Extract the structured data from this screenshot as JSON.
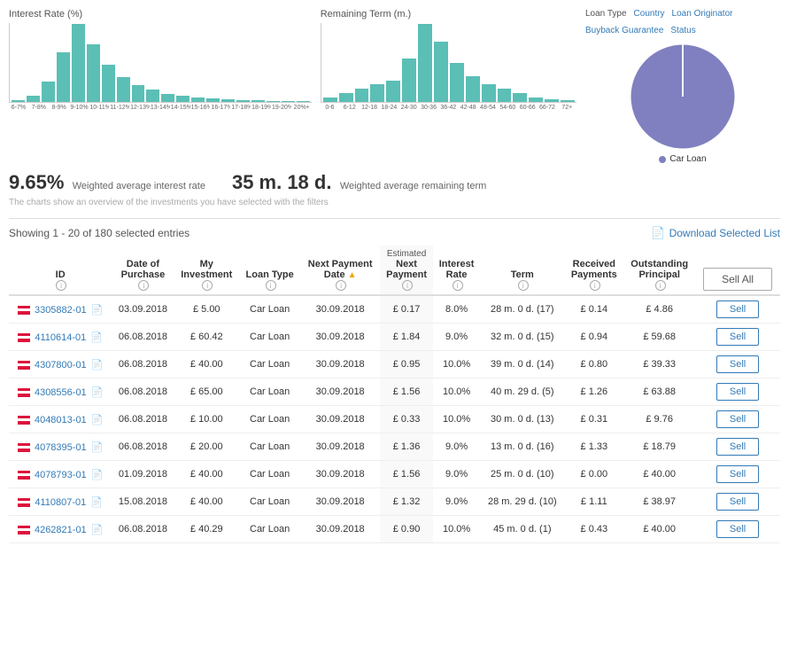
{
  "charts": {
    "interest_rate_title": "Interest Rate (%)",
    "remaining_term_title": "Remaining Term (m.)",
    "interest_bars": [
      2,
      8,
      25,
      60,
      95,
      70,
      45,
      30,
      20,
      15,
      10,
      8,
      5,
      4,
      3,
      2,
      2,
      1,
      1,
      1
    ],
    "interest_labels": [
      "6-7%",
      "7-8%",
      "8-9%",
      "9-10%",
      "10-11%",
      "11-12%",
      "12-13%",
      "13-14%",
      "14-15%",
      "15-16%",
      "16-17%",
      "17-18%",
      "18-19%",
      "19-20%",
      "20%+"
    ],
    "term_bars": [
      5,
      10,
      15,
      20,
      25,
      50,
      90,
      70,
      45,
      30,
      20,
      15,
      10,
      5,
      3,
      2
    ],
    "term_labels": [
      "0-6",
      "6-12",
      "12-18",
      "18-24",
      "24-30",
      "30-36",
      "36-42",
      "42-48",
      "48-54",
      "54-60",
      "60-66",
      "66-72",
      "72+"
    ],
    "weighted_avg_rate": "9.65%",
    "weighted_avg_rate_label": "Weighted average interest rate",
    "weighted_avg_term": "35 m. 18 d.",
    "weighted_avg_term_label": "Weighted average remaining term",
    "note": "The charts show an overview of the investments you have selected with the filters"
  },
  "loan_type_legend": {
    "title": "Loan Type",
    "filters": [
      "Country",
      "Loan Originator",
      "Buyback Guarantee",
      "Status"
    ],
    "items": [
      {
        "label": "Car Loan",
        "color": "#8080c0"
      }
    ]
  },
  "table": {
    "showing_text": "Showing 1 - 20 of 180 selected entries",
    "download_label": "Download Selected List",
    "sell_all_label": "Sell All",
    "columns": [
      {
        "title": "ID",
        "sub": ""
      },
      {
        "title": "Date of Purchase",
        "sub": ""
      },
      {
        "title": "My Investment",
        "sub": ""
      },
      {
        "title": "Loan Type",
        "sub": ""
      },
      {
        "title": "Next Payment Date",
        "sub": ""
      },
      {
        "title": "Estimated Next Payment",
        "sub": ""
      },
      {
        "title": "Interest Rate",
        "sub": ""
      },
      {
        "title": "Term",
        "sub": ""
      },
      {
        "title": "Received Payments",
        "sub": ""
      },
      {
        "title": "Outstanding Principal",
        "sub": ""
      }
    ],
    "rows": [
      {
        "id": "3305882-01",
        "date": "03.09.2018",
        "investment": "£ 5.00",
        "loan_type": "Car Loan",
        "next_payment_date": "30.09.2018",
        "est_next_payment": "£ 0.17",
        "interest_rate": "8.0%",
        "term": "28 m. 0 d. (17)",
        "received": "£ 0.14",
        "outstanding": "£ 4.86"
      },
      {
        "id": "4110614-01",
        "date": "06.08.2018",
        "investment": "£ 60.42",
        "loan_type": "Car Loan",
        "next_payment_date": "30.09.2018",
        "est_next_payment": "£ 1.84",
        "interest_rate": "9.0%",
        "term": "32 m. 0 d. (15)",
        "received": "£ 0.94",
        "outstanding": "£ 59.68"
      },
      {
        "id": "4307800-01",
        "date": "06.08.2018",
        "investment": "£ 40.00",
        "loan_type": "Car Loan",
        "next_payment_date": "30.09.2018",
        "est_next_payment": "£ 0.95",
        "interest_rate": "10.0%",
        "term": "39 m. 0 d. (14)",
        "received": "£ 0.80",
        "outstanding": "£ 39.33"
      },
      {
        "id": "4308556-01",
        "date": "06.08.2018",
        "investment": "£ 65.00",
        "loan_type": "Car Loan",
        "next_payment_date": "30.09.2018",
        "est_next_payment": "£ 1.56",
        "interest_rate": "10.0%",
        "term": "40 m. 29 d. (5)",
        "received": "£ 1.26",
        "outstanding": "£ 63.88"
      },
      {
        "id": "4048013-01",
        "date": "06.08.2018",
        "investment": "£ 10.00",
        "loan_type": "Car Loan",
        "next_payment_date": "30.09.2018",
        "est_next_payment": "£ 0.33",
        "interest_rate": "10.0%",
        "term": "30 m. 0 d. (13)",
        "received": "£ 0.31",
        "outstanding": "£ 9.76"
      },
      {
        "id": "4078395-01",
        "date": "06.08.2018",
        "investment": "£ 20.00",
        "loan_type": "Car Loan",
        "next_payment_date": "30.09.2018",
        "est_next_payment": "£ 1.36",
        "interest_rate": "9.0%",
        "term": "13 m. 0 d. (16)",
        "received": "£ 1.33",
        "outstanding": "£ 18.79"
      },
      {
        "id": "4078793-01",
        "date": "01.09.2018",
        "investment": "£ 40.00",
        "loan_type": "Car Loan",
        "next_payment_date": "30.09.2018",
        "est_next_payment": "£ 1.56",
        "interest_rate": "9.0%",
        "term": "25 m. 0 d. (10)",
        "received": "£ 0.00",
        "outstanding": "£ 40.00"
      },
      {
        "id": "4110807-01",
        "date": "15.08.2018",
        "investment": "£ 40.00",
        "loan_type": "Car Loan",
        "next_payment_date": "30.09.2018",
        "est_next_payment": "£ 1.32",
        "interest_rate": "9.0%",
        "term": "28 m. 29 d. (10)",
        "received": "£ 1.11",
        "outstanding": "£ 38.97"
      },
      {
        "id": "4262821-01",
        "date": "06.08.2018",
        "investment": "£ 40.29",
        "loan_type": "Car Loan",
        "next_payment_date": "30.09.2018",
        "est_next_payment": "£ 0.90",
        "interest_rate": "10.0%",
        "term": "45 m. 0 d. (1)",
        "received": "£ 0.43",
        "outstanding": "£ 40.00"
      }
    ]
  }
}
